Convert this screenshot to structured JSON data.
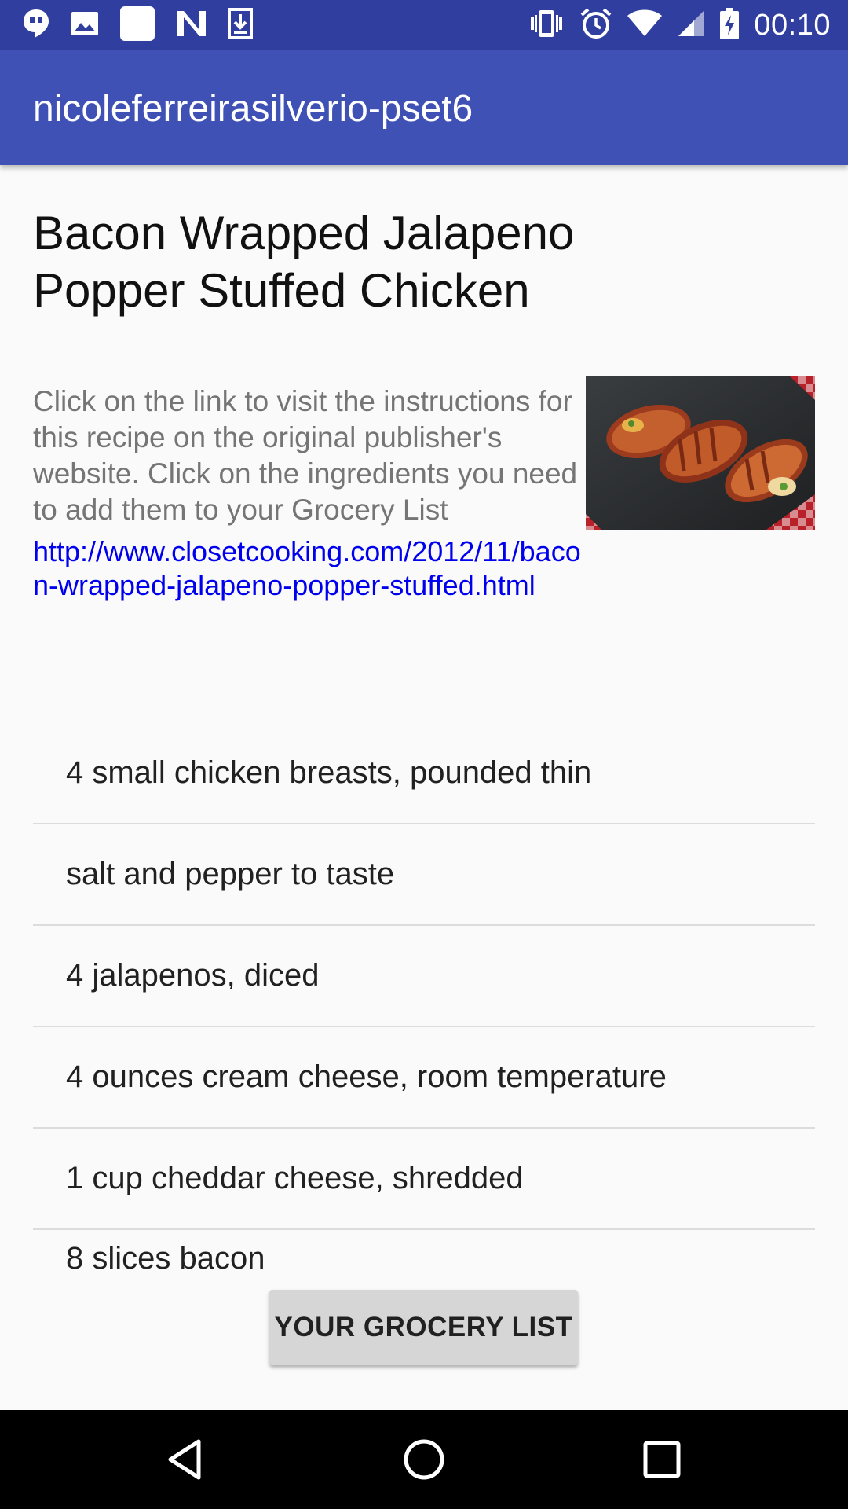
{
  "status_bar": {
    "time": "00:10",
    "left_icons": [
      "hangouts-icon",
      "image-icon",
      "blank-icon",
      "n-logo-icon",
      "download-icon"
    ],
    "right_icons": [
      "vibrate-icon",
      "alarm-icon",
      "wifi-icon",
      "signal-icon",
      "battery-charging-icon"
    ]
  },
  "app_bar": {
    "title": "nicoleferreirasilverio-pset6"
  },
  "recipe": {
    "title": "Bacon Wrapped Jalapeno Popper Stuffed Chicken",
    "description": "Click on the link to visit the instructions for this recipe on the original publisher's website. Click on the ingredients you need to add them to your Grocery List",
    "link": "http://www.closetcooking.com/2012/11/bacon-wrapped-jalapeno-popper-stuffed.html"
  },
  "ingredients": [
    "4 small chicken breasts, pounded thin",
    "salt and pepper to taste",
    "4 jalapenos, diced",
    "4 ounces cream cheese, room temperature",
    "1 cup cheddar cheese, shredded",
    "8 slices bacon"
  ],
  "grocery_button": {
    "label": "YOUR GROCERY LIST"
  },
  "nav_bar": {
    "buttons": [
      "back-icon",
      "home-icon",
      "recents-icon"
    ]
  },
  "colors": {
    "status_bar": "#303f9f",
    "app_bar": "#3f51b5",
    "link": "#0000ee",
    "button": "#d6d6d6"
  }
}
